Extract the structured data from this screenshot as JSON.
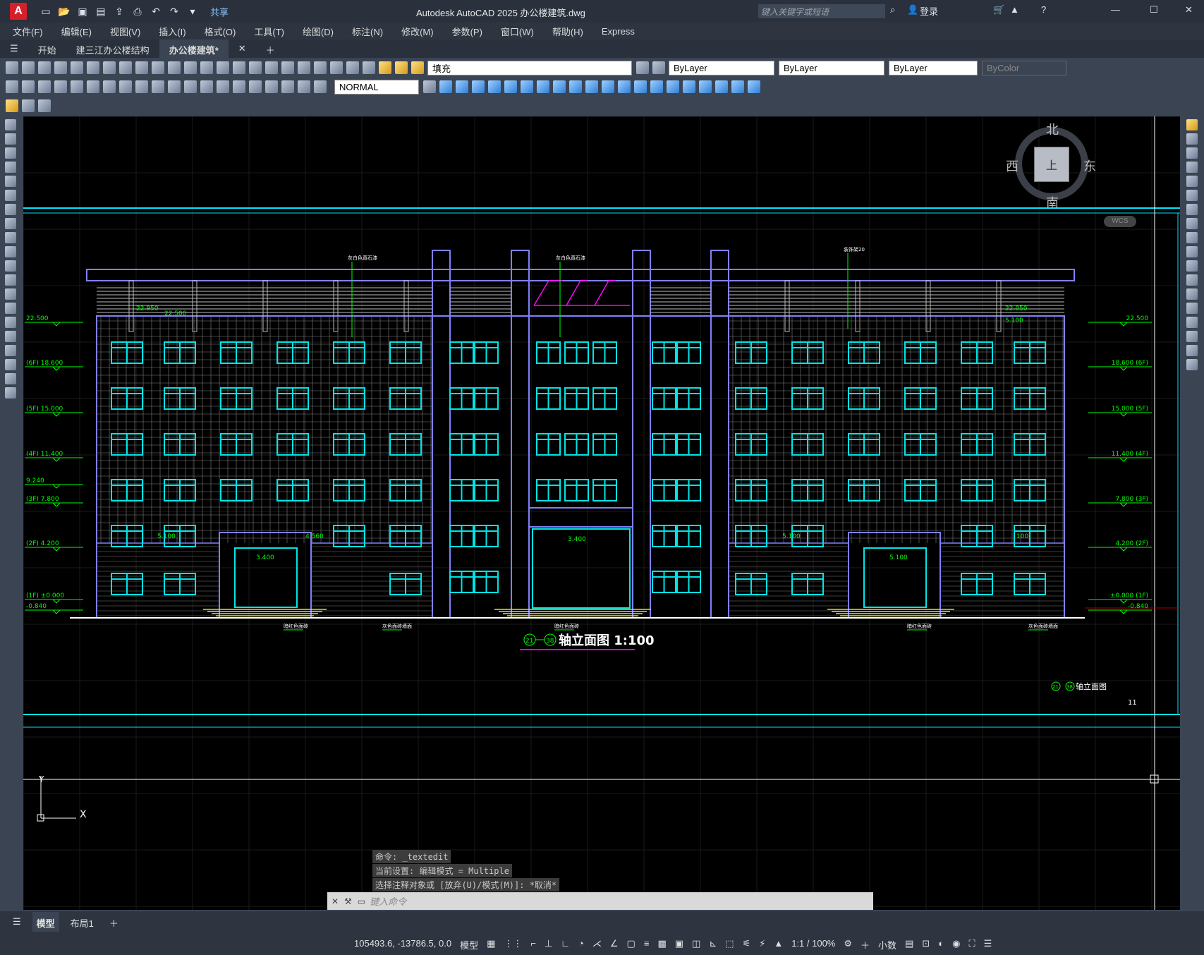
{
  "app": {
    "logo": "A",
    "title": "Autodesk AutoCAD 2025    办公楼建筑.dwg",
    "share": "共享",
    "search_placeholder": "键入关键字或短语",
    "login": "登录"
  },
  "menu": [
    "文件(F)",
    "编辑(E)",
    "视图(V)",
    "插入(I)",
    "格式(O)",
    "工具(T)",
    "绘图(D)",
    "标注(N)",
    "修改(M)",
    "参数(P)",
    "窗口(W)",
    "帮助(H)",
    "Express"
  ],
  "tabs": [
    {
      "label": "开始"
    },
    {
      "label": "建三江办公楼结构"
    },
    {
      "label": "办公楼建筑*"
    }
  ],
  "toolbar": {
    "layer": "填充",
    "color": "ByLayer",
    "linetype": "ByLayer",
    "lineweight": "ByLayer",
    "plotstyle": "ByColor",
    "style": "NORMAL"
  },
  "viewcube": {
    "north": "北",
    "south": "南",
    "east": "东",
    "west": "西",
    "face": "上",
    "wcs": "WCS"
  },
  "drawing": {
    "title": "轴立面图 1:100",
    "title_axes": [
      "21",
      "38"
    ],
    "sheet_label": "轴立面图",
    "sheet_axes": [
      "21",
      "38"
    ],
    "sheet_number": "11",
    "levels_left": [
      "22.500",
      "(6F) 18.600",
      "(5F) 15.000",
      "(4F) 11.400",
      "9.240",
      "(3F) 7.800",
      "(2F) 4.200",
      "(1F) ±0.000",
      "-0.840"
    ],
    "levels_right": [
      "22.500",
      "18.600 (6F)",
      "15.000 (5F)",
      "11.400 (4F)",
      "7.800 (3F)",
      "4.200 (2F)",
      "±0.000 (1F)",
      "-0.840"
    ],
    "notes_top": [
      "灰白色真石漆",
      "灰白色真石漆",
      "装饰架20"
    ],
    "notes_bottom": [
      "暗红色面砖",
      "灰色面砖墙面",
      "暗红色面砖",
      "暗红色面砖",
      "灰色面砖墙面"
    ],
    "dims": [
      "22.950",
      "22.500",
      "22.050",
      "5.100",
      "5.100",
      "4.560",
      "3.400",
      "3.400",
      "5.100",
      "5.100",
      "100"
    ]
  },
  "command": {
    "history": [
      "命令: _textedit",
      "当前设置: 编辑模式 = Multiple",
      "选择注释对象或 [放弃(U)/模式(M)]: *取消*"
    ],
    "placeholder": "键入命令"
  },
  "layout_tabs": [
    "模型",
    "布局1"
  ],
  "status": {
    "coords": "105493.6, -13786.5, 0.0",
    "model": "模型",
    "scale": "1:1 / 100%",
    "units": "小数"
  }
}
